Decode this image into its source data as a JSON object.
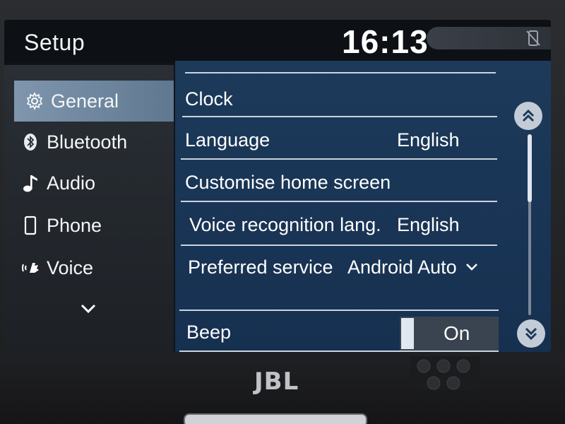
{
  "header": {
    "title": "Setup",
    "clock": "16:13",
    "status_icon": "no-phone-icon"
  },
  "sidebar": {
    "items": [
      {
        "label": "General",
        "icon": "gear-icon",
        "active": true
      },
      {
        "label": "Bluetooth",
        "icon": "bluetooth-icon",
        "active": false
      },
      {
        "label": "Audio",
        "icon": "music-note-icon",
        "active": false
      },
      {
        "label": "Phone",
        "icon": "phone-icon",
        "active": false
      },
      {
        "label": "Voice",
        "icon": "voice-icon",
        "active": false
      }
    ],
    "more_icon": "chevron-down-icon"
  },
  "settings": {
    "rows": [
      {
        "label": "Clock",
        "value": ""
      },
      {
        "label": "Language",
        "value": "English"
      },
      {
        "label": "Customise home screen",
        "value": ""
      },
      {
        "label": "Voice recognition lang.",
        "value": "English"
      },
      {
        "label": "Preferred service",
        "value": "Android Auto"
      },
      {
        "label": "Beep",
        "value": ""
      }
    ],
    "beep_toggle": "On"
  },
  "bezel": {
    "brand": "JBL"
  },
  "colors": {
    "panel": "#1d3a5a",
    "sidebar": "#2a2f35",
    "active_item": "#7f96ad",
    "text": "#ffffff"
  }
}
